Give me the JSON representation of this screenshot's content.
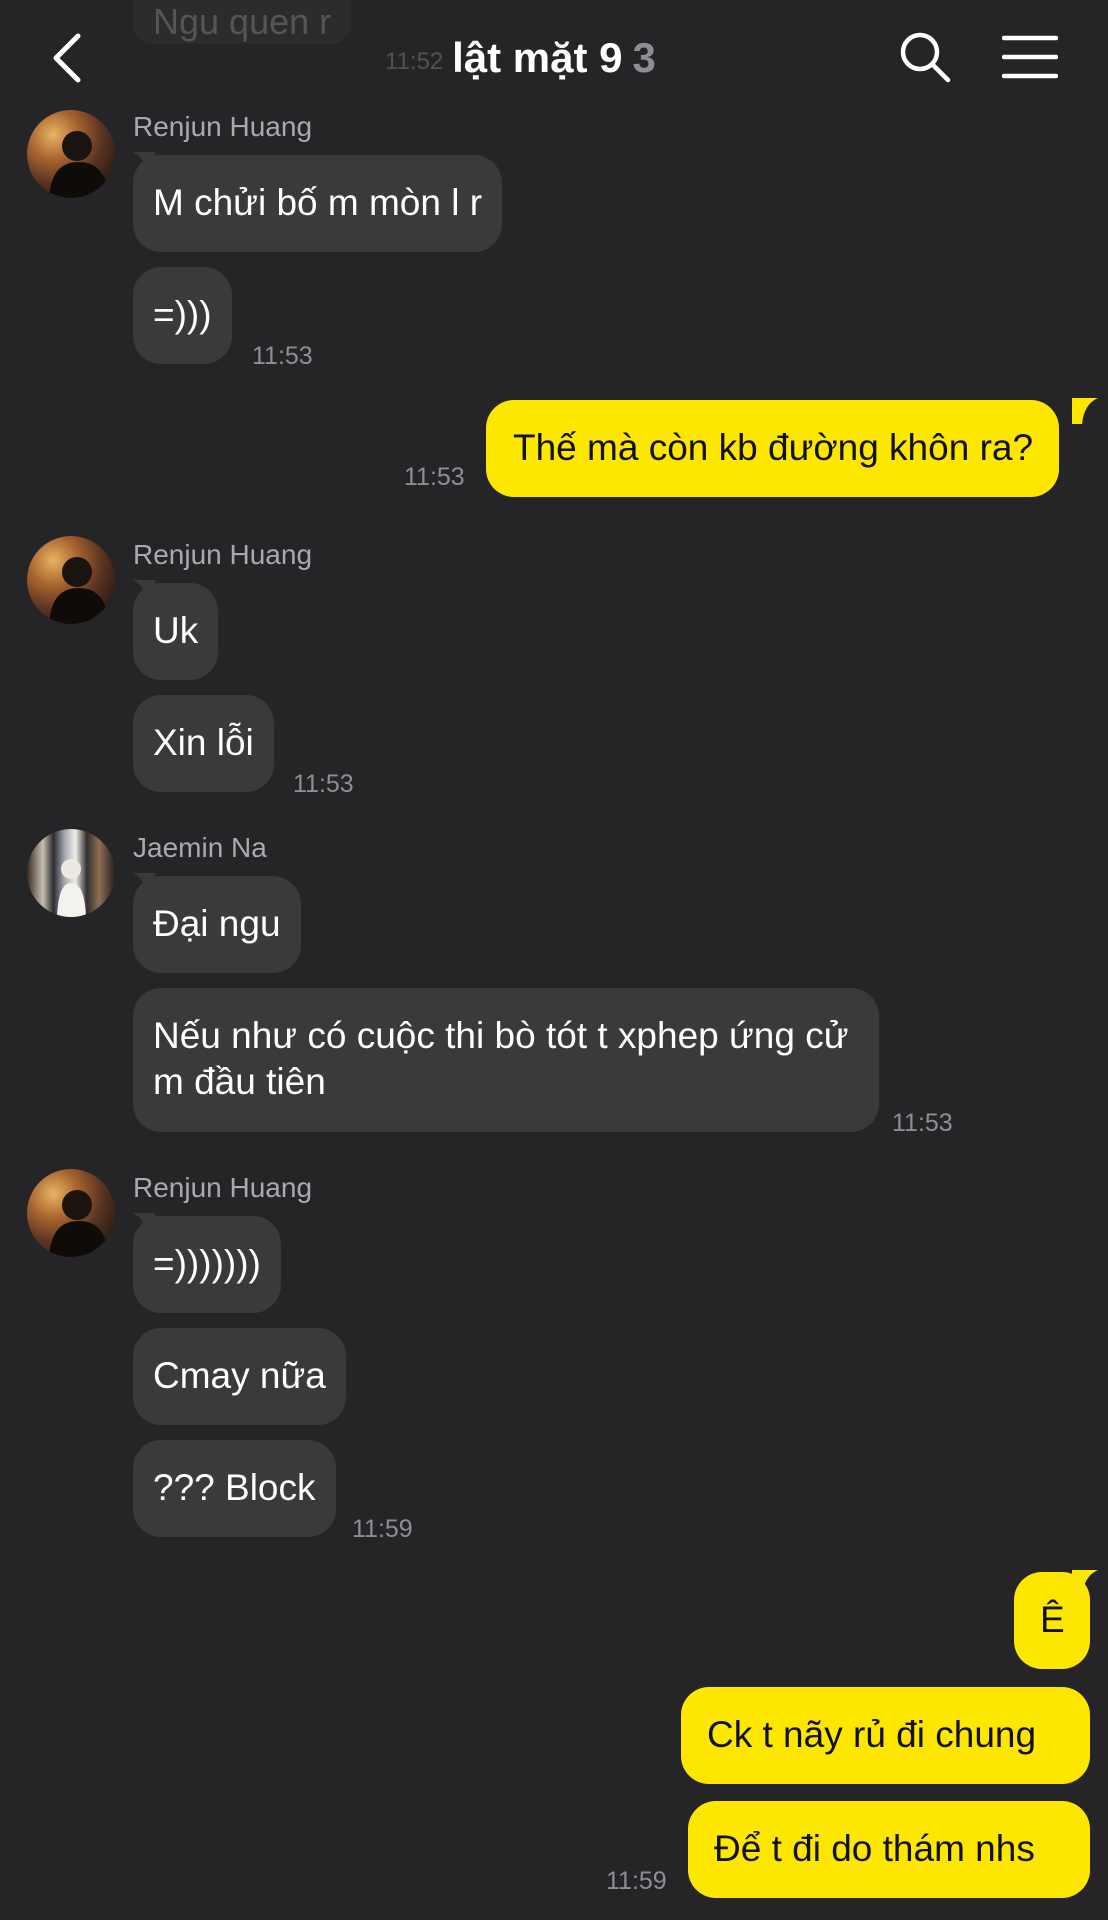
{
  "header": {
    "title": "lật mặt 9",
    "member_count": "3",
    "back_icon": "chevron-left-icon",
    "search_icon": "search-icon",
    "menu_icon": "hamburger-menu-icon"
  },
  "partial_message": {
    "text": "Ngu quen r",
    "time": "11:52"
  },
  "messages": [
    {
      "sender": "Renjun Huang",
      "bubbles": [
        "M chửi bố m mòn l r",
        "=)))"
      ],
      "time": "11:53"
    },
    {
      "sender": "me",
      "bubbles": [
        "Thế mà còn kb đường khôn ra?"
      ],
      "time": "11:53"
    },
    {
      "sender": "Renjun Huang",
      "bubbles": [
        "Uk",
        "Xin lỗi"
      ],
      "time": "11:53"
    },
    {
      "sender": "Jaemin Na",
      "bubbles": [
        "Đại ngu",
        "Nếu như có cuộc thi bò tót t xphep ứng cử m đầu tiên"
      ],
      "time": "11:53"
    },
    {
      "sender": "Renjun Huang",
      "bubbles": [
        "=)))))))",
        "Cmay nữa",
        "??? Block"
      ],
      "time": "11:59"
    },
    {
      "sender": "me",
      "bubbles": [
        "Ê",
        "Ck t nãy rủ đi chung",
        "Để t đi do thám nhs"
      ],
      "time": "11:59"
    }
  ],
  "colors": {
    "background": "#252527",
    "incoming_bubble": "#3a3a3c",
    "outgoing_bubble": "#fde600"
  }
}
